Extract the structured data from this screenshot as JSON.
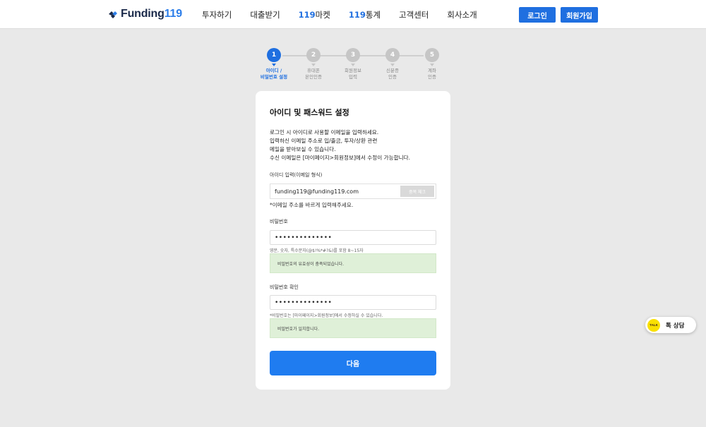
{
  "header": {
    "logo_text": "Funding",
    "logo_num": "119",
    "nav": [
      {
        "prefix": "",
        "label": "투자하기"
      },
      {
        "prefix": "",
        "label": "대출받기"
      },
      {
        "prefix": "119",
        "label": "마켓"
      },
      {
        "prefix": "119",
        "label": "통계"
      },
      {
        "prefix": "",
        "label": "고객센터"
      },
      {
        "prefix": "",
        "label": "회사소개"
      }
    ],
    "login": "로그인",
    "signup": "회원가입"
  },
  "steps": [
    {
      "num": "1",
      "label": "아이디 /\n비밀번호 설정"
    },
    {
      "num": "2",
      "label": "휴대폰\n본인인증"
    },
    {
      "num": "3",
      "label": "회원정보\n입력"
    },
    {
      "num": "4",
      "label": "신분증\n인증"
    },
    {
      "num": "5",
      "label": "계좌\n인증"
    }
  ],
  "form": {
    "title": "아이디 및 패스워드 설정",
    "desc_1": "로그인 시 아이디로 사용할 이메일을 입력하세요.",
    "desc_2": "입력하신 이메일 주소로 입/출금, 투자/상환 관련",
    "desc_3": "메일을 받아보실 수 있습니다.",
    "desc_4": "수신 이메일은 [마이페이지>회원정보]에서 수정이 가능합니다.",
    "id_label": "아이디 입력(이메일 형식)",
    "email_value": "funding119@funding119.com",
    "dup_check": "중복 체크",
    "email_note": "*이메일 주소를 바르게 입력해주세요.",
    "pw_label": "비밀번호",
    "pw_value": "••••••••••••••",
    "pw_rule": "영문, 숫자, 특수문자(@$!%*#?&)를 포함 8~15자",
    "pw_ok": "비밀번호의 유효성이 충족되었습니다.",
    "pw2_label": "비밀번호 확인",
    "pw2_value": "••••••••••••••",
    "pw2_note": "*비밀번호는 [마이페이지>회원정보]에서 수정하실 수 있습니다.",
    "pw2_ok": "비밀번호가 일치합니다.",
    "next": "다음"
  },
  "talk": {
    "badge": "TALK",
    "label": "톡 상담"
  },
  "colors": {
    "accent": "#1f6fe0",
    "success_bg": "#dff0d8",
    "talk_yellow": "#f9e000"
  }
}
